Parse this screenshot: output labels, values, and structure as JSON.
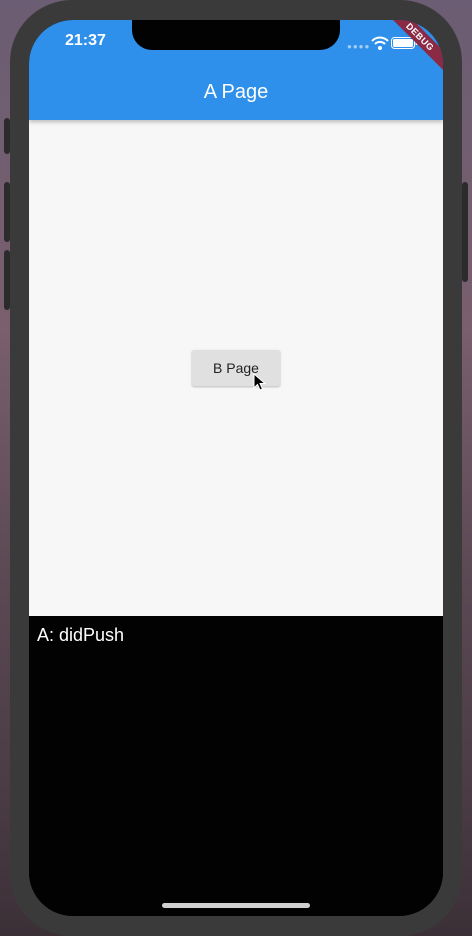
{
  "status_bar": {
    "time": "21:37",
    "icons": [
      "signal-dots-icon",
      "wifi-icon",
      "battery-icon"
    ]
  },
  "debug_banner": {
    "label": "DEBUG",
    "color": "#8b2a45"
  },
  "app_bar": {
    "title": "A Page",
    "color": "#2e90ea"
  },
  "main": {
    "button_label": "B Page",
    "cursor_icon": "mouse-pointer-icon"
  },
  "console": {
    "lines": [
      "A: didPush"
    ]
  }
}
